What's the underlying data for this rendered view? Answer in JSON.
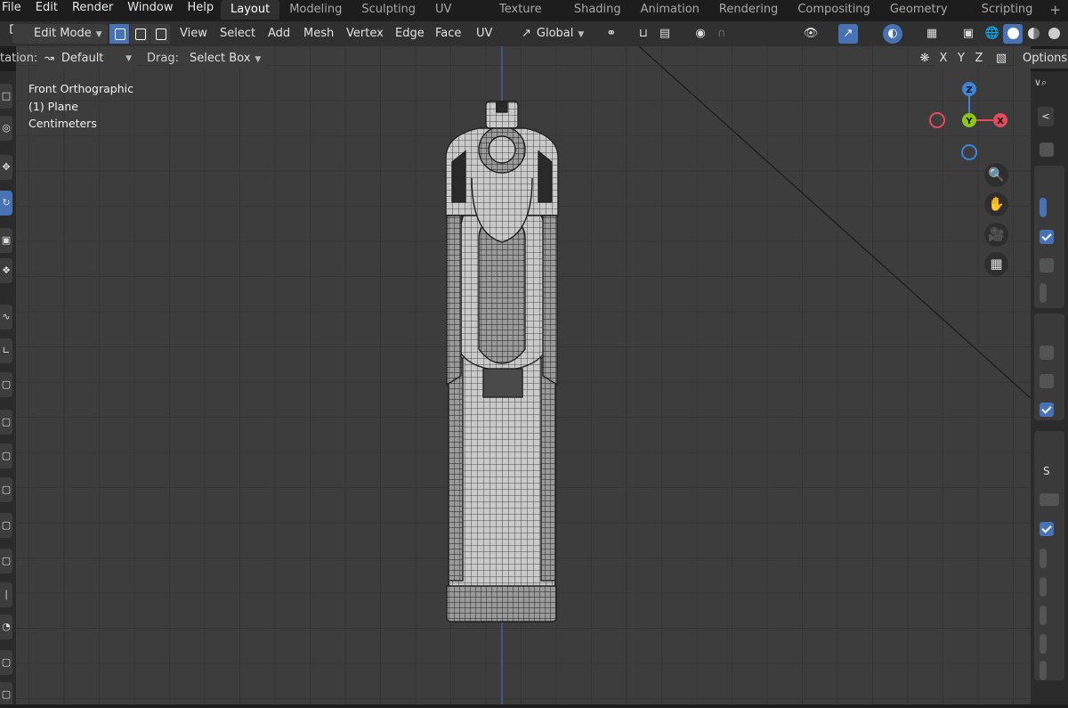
{
  "topbar": {
    "menus": [
      "File",
      "Edit",
      "Render",
      "Window",
      "Help"
    ],
    "workspaces": [
      "Layout",
      "Modeling",
      "Sculpting",
      "UV Editing",
      "Texture Paint",
      "Shading",
      "Animation",
      "Rendering",
      "Compositing",
      "Geometry Nodes",
      "Scripting"
    ],
    "active_workspace": "Layout",
    "add_label": "+"
  },
  "header": {
    "mode_label": "Edit Mode",
    "menus": [
      "View",
      "Select",
      "Add",
      "Mesh",
      "Vertex",
      "Edge",
      "Face",
      "UV"
    ],
    "transform_orientation": "Global"
  },
  "toolrow": {
    "orientation_label": "tation:",
    "orientation_value": "Default",
    "drag_label": "Drag:",
    "drag_value": "Select Box",
    "xyz": [
      "X",
      "Y",
      "Z"
    ],
    "options_label": "Options"
  },
  "viewport": {
    "view_name": "Front Orthographic",
    "object_label": "(1) Plane",
    "units": "Centimeters"
  },
  "gizmo": {
    "z_label": "Z",
    "y_label": "Y",
    "x_label": "X",
    "colors": {
      "x": "#e44b5f",
      "y": "#8bc816",
      "z": "#3b84d8"
    }
  },
  "rightstrip": {
    "s_label": "S"
  },
  "colors": {
    "accent": "#4772b3",
    "viewport_bg": "#3d3d3d",
    "header_bg": "#303030"
  }
}
